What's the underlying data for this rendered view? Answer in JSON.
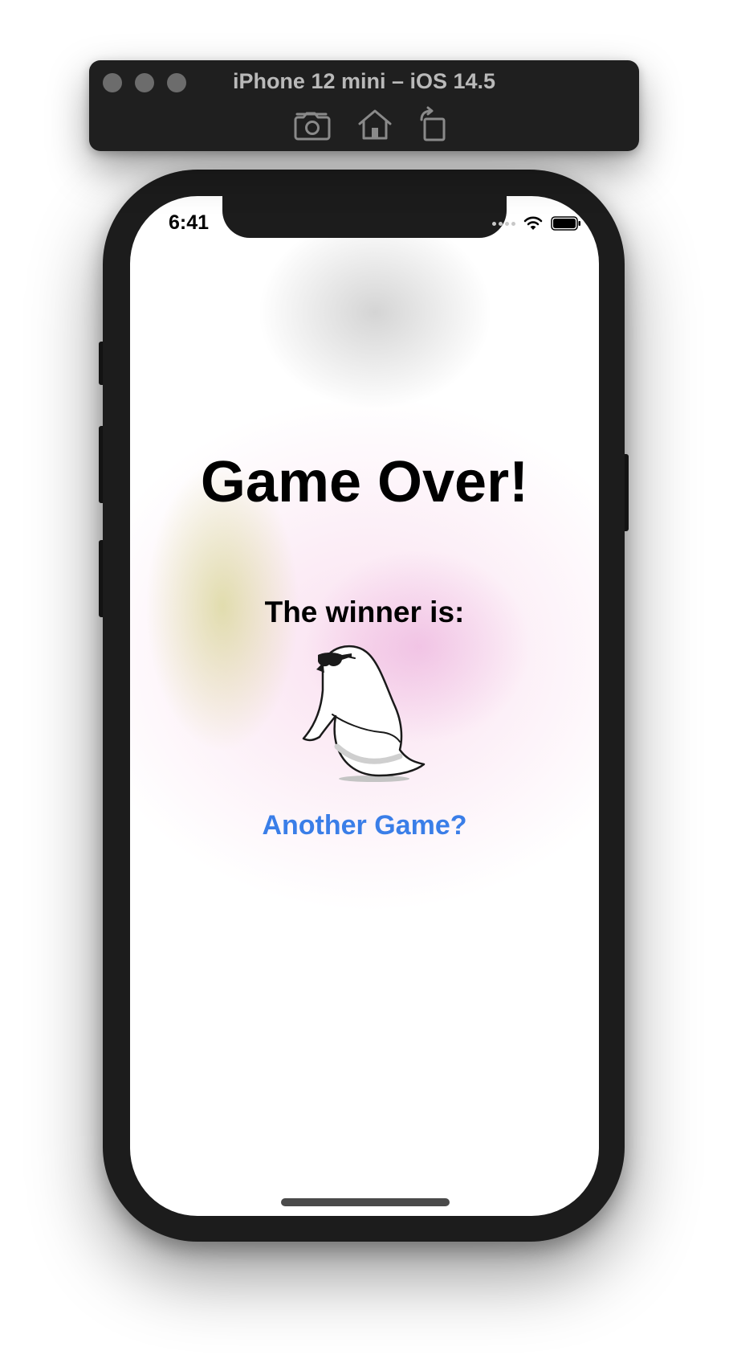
{
  "simulator": {
    "title": "iPhone 12 mini – iOS 14.5",
    "toolbar_icons": [
      "screenshot-icon",
      "home-icon",
      "rotate-icon"
    ]
  },
  "status_bar": {
    "time": "6:41",
    "icons": [
      "wifi-icon",
      "battery-icon"
    ]
  },
  "game_over": {
    "title": "Game Over!",
    "subtitle": "The winner is:",
    "winner_image": "penguin-with-sunglasses",
    "action_button": "Another Game?"
  },
  "colors": {
    "accent": "#3a7ee8",
    "text": "#000000",
    "device_frame": "#1c1c1c"
  }
}
